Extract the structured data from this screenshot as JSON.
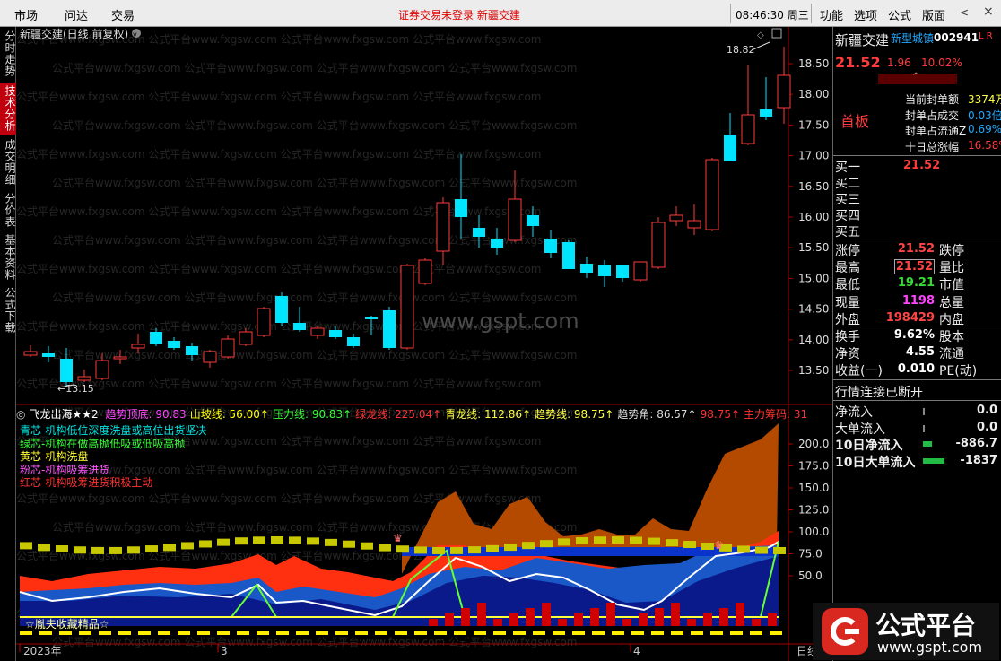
{
  "menubar": {
    "items": [
      "市场",
      "问达",
      "交易"
    ],
    "notice": "证券交易未登录  新疆交建",
    "time": "08:46:30",
    "weekday": "周三",
    "right_items": [
      "功能",
      "选项",
      "公式",
      "版面"
    ],
    "nav_prev": "<",
    "nav_close": "×"
  },
  "sidetabs": [
    "分时走势",
    "技术分析",
    "成交明细",
    "分价表",
    "基本资料",
    "公式下载"
  ],
  "chart": {
    "title": "新疆交建(日线 前复权)",
    "watermark": "www.gspt.com",
    "price_ticks": [
      "18.50",
      "18.00",
      "17.50",
      "17.00",
      "16.50",
      "16.00",
      "15.50",
      "15.00",
      "14.50",
      "14.00",
      "13.50"
    ],
    "high_label": "18.82",
    "low_label": "13.15",
    "indicator_ticks": [
      "200.0",
      "175.0",
      "150.0",
      "125.0",
      "100.0",
      "75.0",
      "50.0"
    ],
    "indicator_bar": {
      "name": "飞龙出海★★2",
      "items": [
        {
          "label": "趋势顶底:",
          "value": "90.83",
          "color": "#ff44ff"
        },
        {
          "label": "山坡线:",
          "value": "56.00↑",
          "color": "#ffff00"
        },
        {
          "label": "压力线:",
          "value": "90.83↑",
          "color": "#33ff33"
        },
        {
          "label": "绿龙线:",
          "value": "225.04↑",
          "color": "#ff3333"
        },
        {
          "label": "青龙线:",
          "value": "112.86↑",
          "color": "#ffff44"
        },
        {
          "label": "趋势线:",
          "value": "98.75↑",
          "color": "#ffff44"
        },
        {
          "label": "趋势角:",
          "value": "86.57↑",
          "color": "#dddddd"
        },
        {
          "label": "",
          "value": "98.75↑",
          "color": "#ff3333"
        },
        {
          "label": "主力筹码:",
          "value": "31",
          "color": "#ff3333"
        }
      ]
    },
    "legend": [
      {
        "text": "青芯-机构低位深度洗盘或高位出货坚决",
        "color": "#00e5e5"
      },
      {
        "text": "绿芯-机构在做高抛低吸或低吸高抛",
        "color": "#33ff33"
      },
      {
        "text": "黄芯-机构洗盘",
        "color": "#ffff33"
      },
      {
        "text": "粉芯-机构吸筹进货",
        "color": "#ff55ff"
      },
      {
        "text": "红芯-机构吸筹进货积极主动",
        "color": "#ff3333"
      }
    ],
    "collector_label": "☆胤夫收藏精品☆",
    "x_labels": [
      "2023年",
      "3",
      "4"
    ],
    "period_label": "日线"
  },
  "quote": {
    "name": "新疆交建",
    "sector": "新型城镇",
    "code": "002941",
    "flags": "L R",
    "price": "21.52",
    "change": "1.96",
    "change_pct": "10.02%",
    "first_board": "首板",
    "seal_rows": [
      {
        "label": "当前封单额",
        "value": "3374万"
      },
      {
        "label": "封单占成交",
        "value": "0.03倍"
      },
      {
        "label": "封单占流通Z",
        "value": "0.69%"
      },
      {
        "label": "十日总涨幅",
        "value": "16.58%"
      }
    ],
    "buy_rows": [
      {
        "label": "买一",
        "value": "21.52"
      },
      {
        "label": "买二",
        "value": ""
      },
      {
        "label": "买三",
        "value": ""
      },
      {
        "label": "买四",
        "value": ""
      },
      {
        "label": "买五",
        "value": ""
      }
    ],
    "stats": [
      {
        "label": "涨停",
        "value": "21.52",
        "label2": "跌停",
        "color": "#ff4444"
      },
      {
        "label": "最高",
        "value": "21.52",
        "label2": "量比",
        "color": "#ff4444"
      },
      {
        "label": "最低",
        "value": "19.21",
        "label2": "市值",
        "color": "#33dd33"
      },
      {
        "label": "现量",
        "value": "1198",
        "label2": "总量",
        "color": "#ff44ff"
      },
      {
        "label": "外盘",
        "value": "198429",
        "label2": "内盘",
        "color": "#ff4444"
      },
      {
        "label": "换手",
        "value": "9.62%",
        "label2": "股本",
        "color": "#ffffff"
      },
      {
        "label": "净资",
        "value": "4.55",
        "label2": "流通",
        "color": "#ffffff"
      },
      {
        "label": "收益(一)",
        "value": "0.010",
        "label2": "PE(动)",
        "color": "#ffffff"
      }
    ],
    "conn_status": "行情连接已断开",
    "flows": [
      {
        "label": "净流入",
        "value": "0.0"
      },
      {
        "label": "大单流入",
        "value": "0.0"
      },
      {
        "label": "10日净流入",
        "value": "-886.7"
      },
      {
        "label": "10日大单流入",
        "value": "-1837"
      }
    ]
  },
  "logo": {
    "title": "公式平台",
    "url": "www.gspt.com"
  }
}
